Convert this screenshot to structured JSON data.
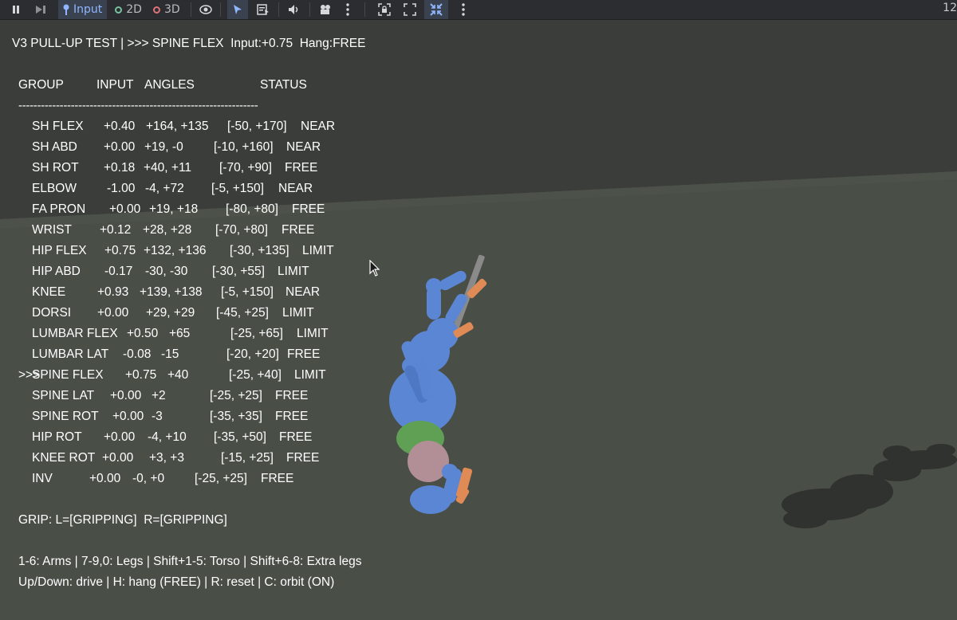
{
  "toolbar": {
    "input_label": "Input",
    "mode_2d_label": "2D",
    "mode_3d_label": "3D",
    "corner_text": "12",
    "colors": {
      "bg": "#2b2d31",
      "accent": "#8fb6ff",
      "mode_2d_dot": "#78c2a0",
      "mode_3d_dot": "#e0727a"
    }
  },
  "hud": {
    "title": "V3 PULL-UP TEST | >>> SPINE FLEX  Input:+0.75  Hang:FREE",
    "headers": {
      "group": "GROUP",
      "input": "INPUT",
      "angles": "ANGLES",
      "status": "STATUS"
    },
    "divider": "----------------------------------------------------------------",
    "rows": [
      {
        "prefix": "",
        "group": "SH FLEX",
        "input": "+0.40",
        "angles": "+164, +135",
        "range": "[-50, +170]",
        "status": "NEAR"
      },
      {
        "prefix": "",
        "group": "SH ABD",
        "input": "+0.00",
        "angles": "+19, -0",
        "range": "[-10, +160]",
        "status": "NEAR"
      },
      {
        "prefix": "",
        "group": "SH ROT",
        "input": "+0.18",
        "angles": "+40, +11",
        "range": "[-70, +90]",
        "status": "FREE"
      },
      {
        "prefix": "",
        "group": "ELBOW",
        "input": "-1.00",
        "angles": "-4, +72",
        "range": "[-5, +150]",
        "status": "NEAR"
      },
      {
        "prefix": "",
        "group": "FA PRON",
        "input": "+0.00",
        "angles": "+19, +18",
        "range": "[-80, +80]",
        "status": "FREE"
      },
      {
        "prefix": "",
        "group": "WRIST",
        "input": "+0.12",
        "angles": "+28, +28",
        "range": "[-70, +80]",
        "status": "FREE"
      },
      {
        "prefix": "",
        "group": "HIP FLEX",
        "input": "+0.75",
        "angles": "+132, +136",
        "range": "[-30, +135]",
        "status": "LIMIT"
      },
      {
        "prefix": "",
        "group": "HIP ABD",
        "input": "-0.17",
        "angles": "-30, -30",
        "range": "[-30, +55]",
        "status": "LIMIT"
      },
      {
        "prefix": "",
        "group": "KNEE",
        "input": "+0.93",
        "angles": "+139, +138",
        "range": "[-5, +150]",
        "status": "NEAR"
      },
      {
        "prefix": "",
        "group": "DORSI",
        "input": "+0.00",
        "angles": "+29, +29",
        "range": "[-45, +25]",
        "status": "LIMIT"
      },
      {
        "prefix": "",
        "group": "LUMBAR FLEX",
        "input": "+0.50",
        "angles": "+65",
        "range": "[-25, +65]",
        "status": "LIMIT"
      },
      {
        "prefix": "",
        "group": "LUMBAR LAT",
        "input": "-0.08",
        "angles": "-15",
        "range": "[-20, +20]",
        "status": "FREE"
      },
      {
        "prefix": ">>>",
        "group": "SPINE FLEX",
        "input": "+0.75",
        "angles": "+40",
        "range": "[-25, +40]",
        "status": "LIMIT"
      },
      {
        "prefix": "",
        "group": "SPINE LAT",
        "input": "+0.00",
        "angles": "+2",
        "range": "[-25, +25]",
        "status": "FREE"
      },
      {
        "prefix": "",
        "group": "SPINE ROT",
        "input": "+0.00",
        "angles": "-3",
        "range": "[-35, +35]",
        "status": "FREE"
      },
      {
        "prefix": "",
        "group": "HIP ROT",
        "input": "+0.00",
        "angles": "-4, +10",
        "range": "[-35, +50]",
        "status": "FREE"
      },
      {
        "prefix": "",
        "group": "KNEE ROT",
        "input": "+0.00",
        "angles": "+3, +3",
        "range": "[-15, +25]",
        "status": "FREE"
      },
      {
        "prefix": "",
        "group": "INV",
        "input": "+0.00",
        "angles": "-0, +0",
        "range": "[-25, +25]",
        "status": "FREE"
      }
    ],
    "grip": "GRIP: L=[GRIPPING]  R=[GRIPPING]",
    "help_line1": "1-6: Arms | 7-9,0: Legs | Shift+1-5: Torso | Shift+6-8: Extra legs",
    "help_line2": "Up/Down: drive | H: hang (FREE) | R: reset | C: orbit (ON)"
  },
  "scene": {
    "colors": {
      "sky": "#3b3d3b",
      "ground": "#4a5048",
      "body": "#5b86d4",
      "torso_green": "#5fa055",
      "pelvis": "#b28e96",
      "hands_feet": "#e08a55",
      "bar": "#8a8a8a"
    }
  }
}
